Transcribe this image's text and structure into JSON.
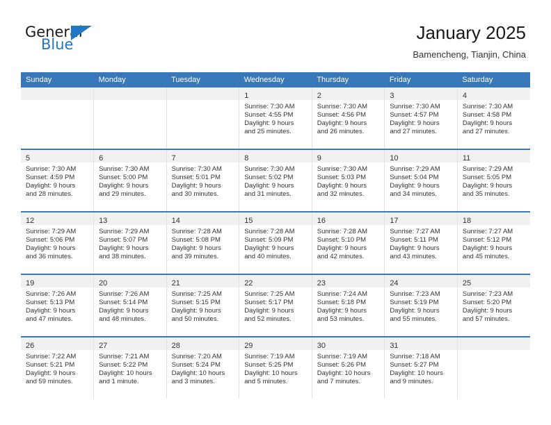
{
  "brand": {
    "name_part1": "General",
    "name_part2": "Blue",
    "logo_icon": "blue-triangle-icon"
  },
  "header": {
    "month_title": "January 2025",
    "location": "Bamencheng, Tianjin, China"
  },
  "theme": {
    "header_blue": "#3878b8",
    "brand_blue": "#1f78c1",
    "daynum_band": "#f1f1f1",
    "text": "#333333"
  },
  "calendar": {
    "weekday_headers": [
      "Sunday",
      "Monday",
      "Tuesday",
      "Wednesday",
      "Thursday",
      "Friday",
      "Saturday"
    ],
    "weeks": [
      [
        {
          "empty": true
        },
        {
          "empty": true
        },
        {
          "empty": true
        },
        {
          "day": "1",
          "sunrise": "Sunrise: 7:30 AM",
          "sunset": "Sunset: 4:55 PM",
          "daylight1": "Daylight: 9 hours",
          "daylight2": "and 25 minutes."
        },
        {
          "day": "2",
          "sunrise": "Sunrise: 7:30 AM",
          "sunset": "Sunset: 4:56 PM",
          "daylight1": "Daylight: 9 hours",
          "daylight2": "and 26 minutes."
        },
        {
          "day": "3",
          "sunrise": "Sunrise: 7:30 AM",
          "sunset": "Sunset: 4:57 PM",
          "daylight1": "Daylight: 9 hours",
          "daylight2": "and 27 minutes."
        },
        {
          "day": "4",
          "sunrise": "Sunrise: 7:30 AM",
          "sunset": "Sunset: 4:58 PM",
          "daylight1": "Daylight: 9 hours",
          "daylight2": "and 27 minutes."
        }
      ],
      [
        {
          "day": "5",
          "sunrise": "Sunrise: 7:30 AM",
          "sunset": "Sunset: 4:59 PM",
          "daylight1": "Daylight: 9 hours",
          "daylight2": "and 28 minutes."
        },
        {
          "day": "6",
          "sunrise": "Sunrise: 7:30 AM",
          "sunset": "Sunset: 5:00 PM",
          "daylight1": "Daylight: 9 hours",
          "daylight2": "and 29 minutes."
        },
        {
          "day": "7",
          "sunrise": "Sunrise: 7:30 AM",
          "sunset": "Sunset: 5:01 PM",
          "daylight1": "Daylight: 9 hours",
          "daylight2": "and 30 minutes."
        },
        {
          "day": "8",
          "sunrise": "Sunrise: 7:30 AM",
          "sunset": "Sunset: 5:02 PM",
          "daylight1": "Daylight: 9 hours",
          "daylight2": "and 31 minutes."
        },
        {
          "day": "9",
          "sunrise": "Sunrise: 7:30 AM",
          "sunset": "Sunset: 5:03 PM",
          "daylight1": "Daylight: 9 hours",
          "daylight2": "and 32 minutes."
        },
        {
          "day": "10",
          "sunrise": "Sunrise: 7:29 AM",
          "sunset": "Sunset: 5:04 PM",
          "daylight1": "Daylight: 9 hours",
          "daylight2": "and 34 minutes."
        },
        {
          "day": "11",
          "sunrise": "Sunrise: 7:29 AM",
          "sunset": "Sunset: 5:05 PM",
          "daylight1": "Daylight: 9 hours",
          "daylight2": "and 35 minutes."
        }
      ],
      [
        {
          "day": "12",
          "sunrise": "Sunrise: 7:29 AM",
          "sunset": "Sunset: 5:06 PM",
          "daylight1": "Daylight: 9 hours",
          "daylight2": "and 36 minutes."
        },
        {
          "day": "13",
          "sunrise": "Sunrise: 7:29 AM",
          "sunset": "Sunset: 5:07 PM",
          "daylight1": "Daylight: 9 hours",
          "daylight2": "and 38 minutes."
        },
        {
          "day": "14",
          "sunrise": "Sunrise: 7:28 AM",
          "sunset": "Sunset: 5:08 PM",
          "daylight1": "Daylight: 9 hours",
          "daylight2": "and 39 minutes."
        },
        {
          "day": "15",
          "sunrise": "Sunrise: 7:28 AM",
          "sunset": "Sunset: 5:09 PM",
          "daylight1": "Daylight: 9 hours",
          "daylight2": "and 40 minutes."
        },
        {
          "day": "16",
          "sunrise": "Sunrise: 7:28 AM",
          "sunset": "Sunset: 5:10 PM",
          "daylight1": "Daylight: 9 hours",
          "daylight2": "and 42 minutes."
        },
        {
          "day": "17",
          "sunrise": "Sunrise: 7:27 AM",
          "sunset": "Sunset: 5:11 PM",
          "daylight1": "Daylight: 9 hours",
          "daylight2": "and 43 minutes."
        },
        {
          "day": "18",
          "sunrise": "Sunrise: 7:27 AM",
          "sunset": "Sunset: 5:12 PM",
          "daylight1": "Daylight: 9 hours",
          "daylight2": "and 45 minutes."
        }
      ],
      [
        {
          "day": "19",
          "sunrise": "Sunrise: 7:26 AM",
          "sunset": "Sunset: 5:13 PM",
          "daylight1": "Daylight: 9 hours",
          "daylight2": "and 47 minutes."
        },
        {
          "day": "20",
          "sunrise": "Sunrise: 7:26 AM",
          "sunset": "Sunset: 5:14 PM",
          "daylight1": "Daylight: 9 hours",
          "daylight2": "and 48 minutes."
        },
        {
          "day": "21",
          "sunrise": "Sunrise: 7:25 AM",
          "sunset": "Sunset: 5:15 PM",
          "daylight1": "Daylight: 9 hours",
          "daylight2": "and 50 minutes."
        },
        {
          "day": "22",
          "sunrise": "Sunrise: 7:25 AM",
          "sunset": "Sunset: 5:17 PM",
          "daylight1": "Daylight: 9 hours",
          "daylight2": "and 52 minutes."
        },
        {
          "day": "23",
          "sunrise": "Sunrise: 7:24 AM",
          "sunset": "Sunset: 5:18 PM",
          "daylight1": "Daylight: 9 hours",
          "daylight2": "and 53 minutes."
        },
        {
          "day": "24",
          "sunrise": "Sunrise: 7:23 AM",
          "sunset": "Sunset: 5:19 PM",
          "daylight1": "Daylight: 9 hours",
          "daylight2": "and 55 minutes."
        },
        {
          "day": "25",
          "sunrise": "Sunrise: 7:23 AM",
          "sunset": "Sunset: 5:20 PM",
          "daylight1": "Daylight: 9 hours",
          "daylight2": "and 57 minutes."
        }
      ],
      [
        {
          "day": "26",
          "sunrise": "Sunrise: 7:22 AM",
          "sunset": "Sunset: 5:21 PM",
          "daylight1": "Daylight: 9 hours",
          "daylight2": "and 59 minutes."
        },
        {
          "day": "27",
          "sunrise": "Sunrise: 7:21 AM",
          "sunset": "Sunset: 5:22 PM",
          "daylight1": "Daylight: 10 hours",
          "daylight2": "and 1 minute."
        },
        {
          "day": "28",
          "sunrise": "Sunrise: 7:20 AM",
          "sunset": "Sunset: 5:24 PM",
          "daylight1": "Daylight: 10 hours",
          "daylight2": "and 3 minutes."
        },
        {
          "day": "29",
          "sunrise": "Sunrise: 7:19 AM",
          "sunset": "Sunset: 5:25 PM",
          "daylight1": "Daylight: 10 hours",
          "daylight2": "and 5 minutes."
        },
        {
          "day": "30",
          "sunrise": "Sunrise: 7:19 AM",
          "sunset": "Sunset: 5:26 PM",
          "daylight1": "Daylight: 10 hours",
          "daylight2": "and 7 minutes."
        },
        {
          "day": "31",
          "sunrise": "Sunrise: 7:18 AM",
          "sunset": "Sunset: 5:27 PM",
          "daylight1": "Daylight: 10 hours",
          "daylight2": "and 9 minutes."
        },
        {
          "empty": true
        }
      ]
    ]
  }
}
